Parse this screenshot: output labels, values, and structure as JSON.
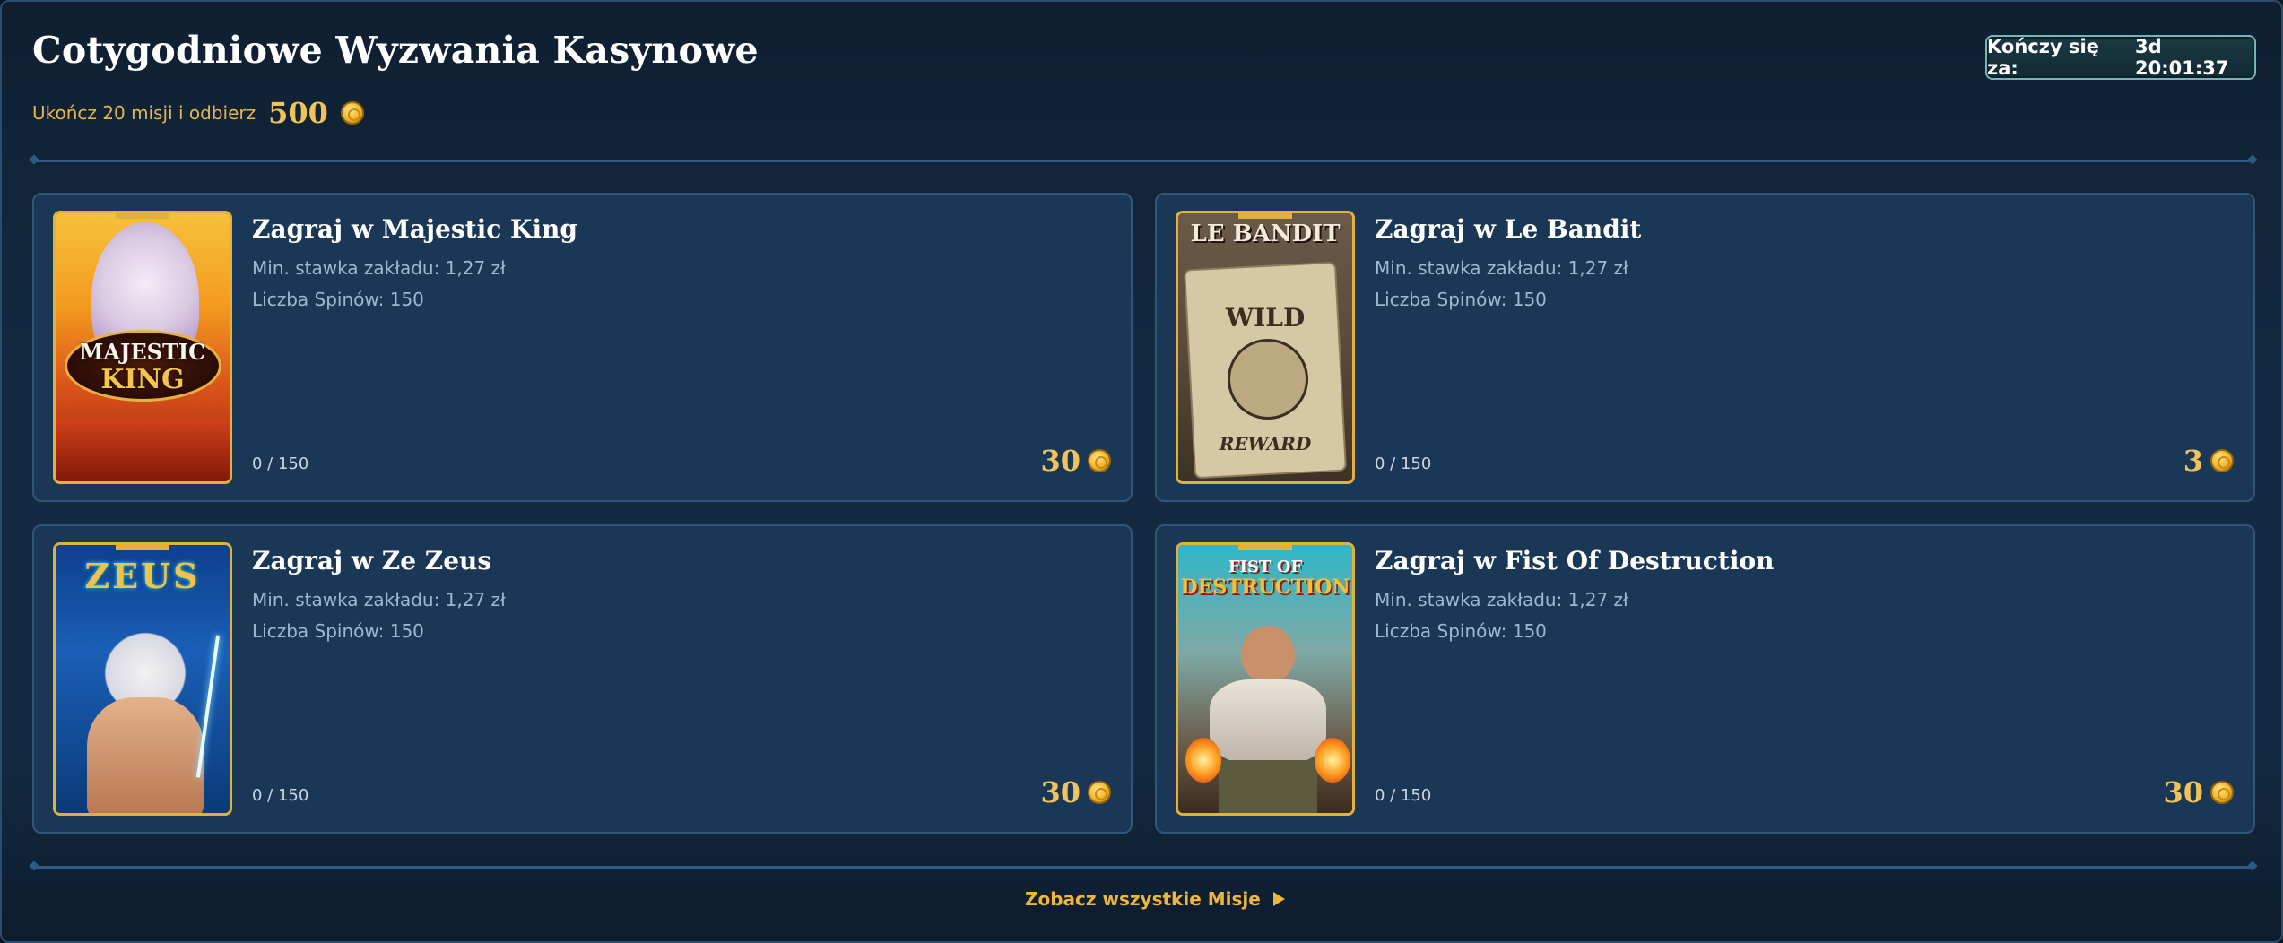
{
  "header": {
    "title": "Cotygodniowe Wyzwania Kasynowe",
    "subtitle_text": "Ukończ 20 misji i odbierz",
    "subtitle_amount": "500",
    "timer_label": "Kończy się za:",
    "timer_value": "3d 20:01:37"
  },
  "missions": [
    {
      "title": "Zagraj w Majestic King",
      "min_bet": "Min. stawka zakładu: 1,27 zł",
      "spins": "Liczba Spinów: 150",
      "progress": "0 / 150",
      "reward": "30",
      "thumb_text": [
        "MAJESTIC",
        "KING"
      ]
    },
    {
      "title": "Zagraj w Le Bandit",
      "min_bet": "Min. stawka zakładu: 1,27 zł",
      "spins": "Liczba Spinów: 150",
      "progress": "0 / 150",
      "reward": "3",
      "thumb_text": [
        "LE BANDIT",
        "WILD",
        "REWARD"
      ]
    },
    {
      "title": "Zagraj w Ze Zeus",
      "min_bet": "Min. stawka zakładu: 1,27 zł",
      "spins": "Liczba Spinów: 150",
      "progress": "0 / 150",
      "reward": "30",
      "thumb_text": [
        "ZEUS"
      ]
    },
    {
      "title": "Zagraj w Fist Of Destruction",
      "min_bet": "Min. stawka zakładu: 1,27 zł",
      "spins": "Liczba Spinów: 150",
      "progress": "0 / 150",
      "reward": "30",
      "thumb_text": [
        "FIST OF",
        "DESTRUCTION"
      ]
    }
  ],
  "footer": {
    "see_all_label": "Zobacz wszystkie Misje"
  },
  "colors": {
    "accent_gold": "#f0c35a",
    "card_bg": "#1a3856",
    "page_bg": "#132a42"
  },
  "icons": [
    "coin-icon",
    "play-arrow-icon"
  ]
}
